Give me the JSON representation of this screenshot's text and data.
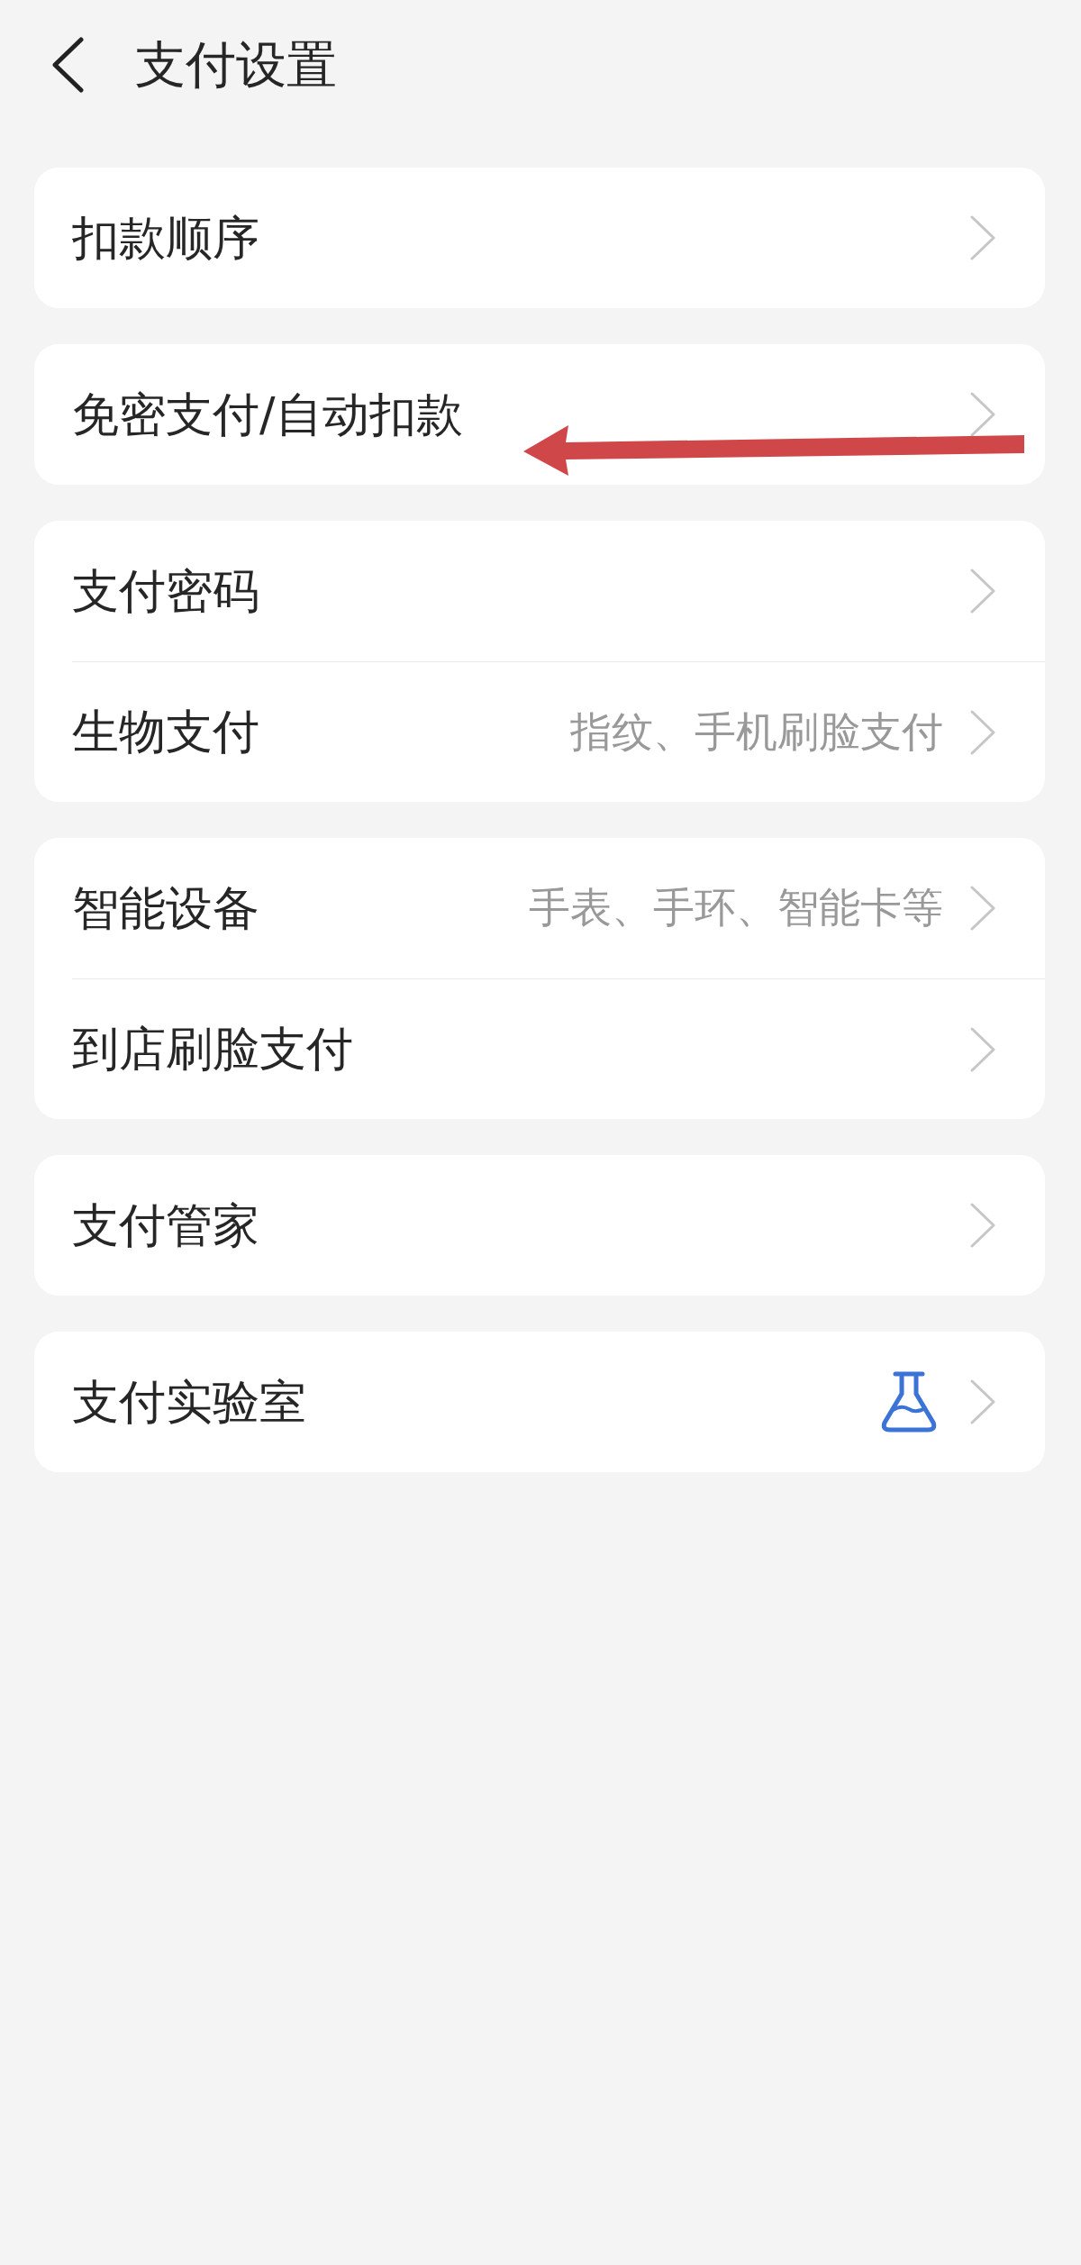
{
  "header": {
    "title": "支付设置"
  },
  "groups": [
    {
      "items": [
        {
          "kind": "plain",
          "label": "扣款顺序",
          "pointed_by_arrow": false
        }
      ]
    },
    {
      "items": [
        {
          "kind": "plain",
          "label": "免密支付/自动扣款",
          "pointed_by_arrow": true
        }
      ]
    },
    {
      "items": [
        {
          "kind": "plain",
          "label": "支付密码",
          "pointed_by_arrow": false
        },
        {
          "kind": "detail",
          "label": "生物支付",
          "value": "指纹、手机刷脸支付",
          "pointed_by_arrow": false
        }
      ]
    },
    {
      "items": [
        {
          "kind": "detail",
          "label": "智能设备",
          "value": "手表、手环、智能卡等",
          "pointed_by_arrow": false
        },
        {
          "kind": "plain",
          "label": "到店刷脸支付",
          "pointed_by_arrow": false
        }
      ]
    },
    {
      "items": [
        {
          "kind": "plain",
          "label": "支付管家",
          "pointed_by_arrow": false
        }
      ]
    },
    {
      "items": [
        {
          "kind": "icon",
          "label": "支付实验室",
          "pointed_by_arrow": false
        }
      ]
    }
  ]
}
